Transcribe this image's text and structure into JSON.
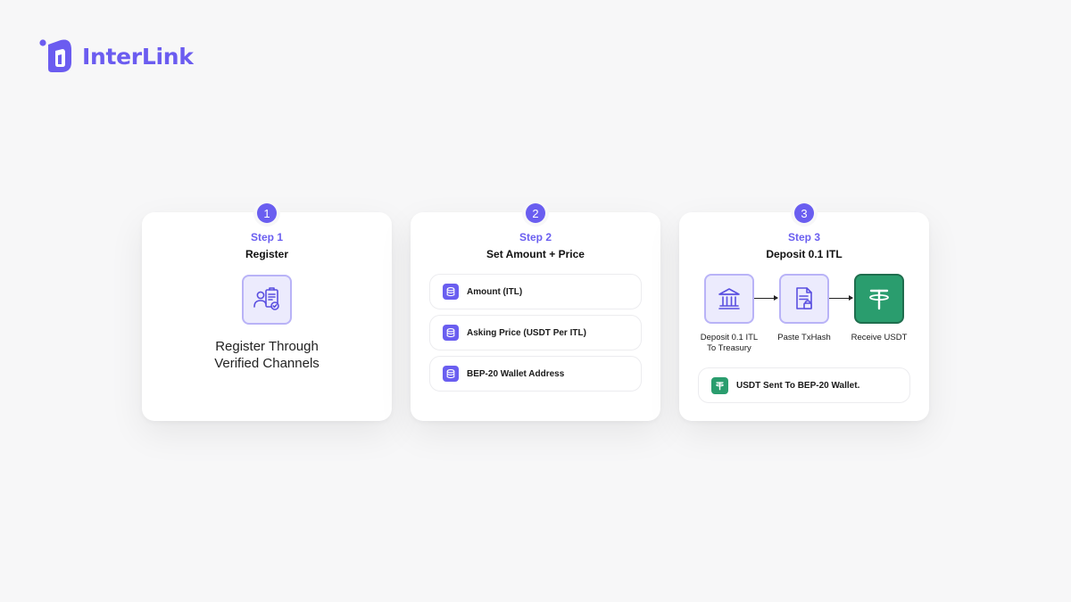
{
  "brand": {
    "name": "InterLink",
    "logo_icon": "interlink-logo-icon",
    "color": "#6b5cf0"
  },
  "steps": [
    {
      "number": "1",
      "label": "Step 1",
      "title": "Register",
      "icon": "registration-clipboard-icon",
      "description_lines": [
        "Register Through",
        "Verified Channels"
      ]
    },
    {
      "number": "2",
      "label": "Step 2",
      "title": "Set Amount + Price",
      "icon": "database-icon",
      "fields": [
        "Amount (ITL)",
        "Asking Price (USDT Per ITL)",
        "BEP-20 Wallet Address"
      ]
    },
    {
      "number": "3",
      "label": "Step 3",
      "title": "Deposit 0.1 ITL",
      "flow": [
        {
          "icon": "bank-icon",
          "lines": [
            "Deposit 0.1 ITL",
            "To Treasury"
          ]
        },
        {
          "icon": "document-lock-icon",
          "lines": [
            "Paste TxHash"
          ]
        },
        {
          "icon": "tether-icon",
          "lines": [
            "Receive USDT"
          ]
        }
      ],
      "note": "USDT Sent To BEP-20 Wallet."
    }
  ],
  "colors": {
    "accent": "#6a5ef0",
    "accent_light": "#ecebfd",
    "tether": "#2a9d6e"
  }
}
